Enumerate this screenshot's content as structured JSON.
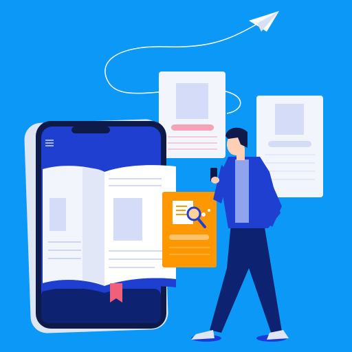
{
  "colors": {
    "background": "#0b98f6",
    "phone_frame": "#0d1a4a",
    "phone_screen": "#1f3fd0",
    "phone_bezel": "#dfe6f3",
    "book_page": "#ffffff",
    "book_shade": "#e9eefb",
    "placeholder_block": "#d4dcf7",
    "line": "#a9b6ee",
    "accent_pink": "#f5a3b5",
    "orange_card": "#ff9800",
    "jacket": "#1f3fd0",
    "pants": "#0d2270",
    "skin": "#ffd0b5",
    "hair": "#0d1a4a",
    "shirt": "#8fa3ee"
  },
  "icons": [
    "paper-plane-icon",
    "hamburger-menu-icon",
    "magnifier-document-icon",
    "bookmark-icon"
  ]
}
